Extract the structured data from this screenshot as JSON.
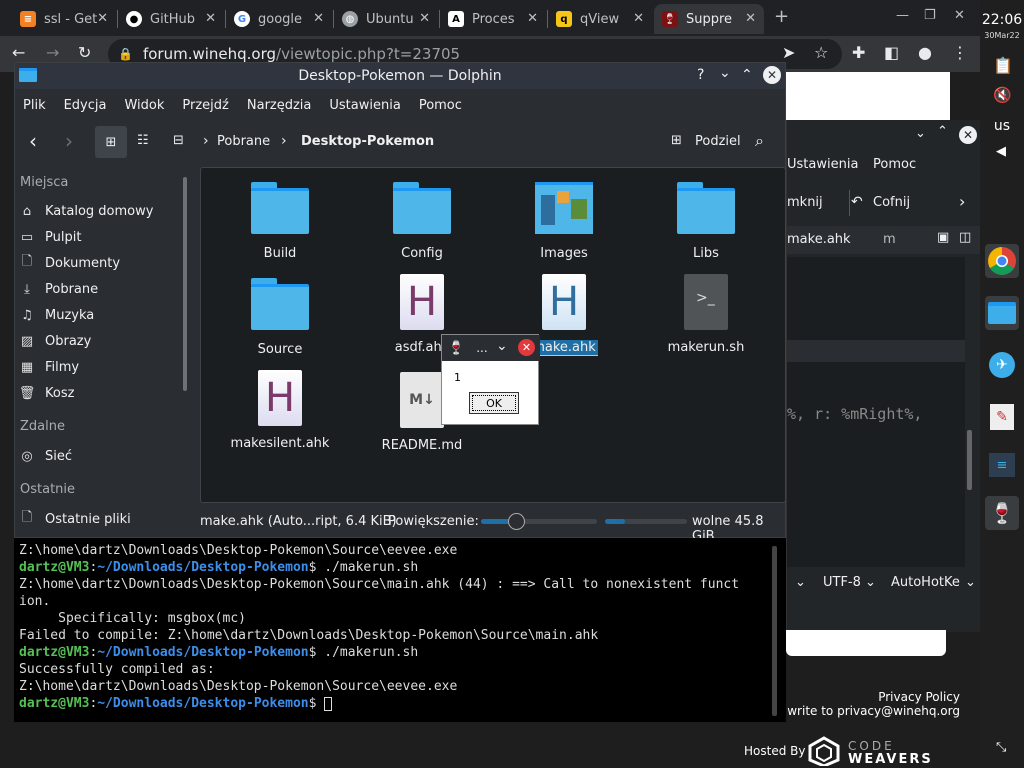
{
  "browser": {
    "tabs": [
      {
        "title": "ssl - Get",
        "icon": "stackoverflow-icon"
      },
      {
        "title": "GitHub",
        "icon": "github-icon"
      },
      {
        "title": "google",
        "icon": "google-icon"
      },
      {
        "title": "Ubuntu",
        "icon": "globe-icon"
      },
      {
        "title": "Proces",
        "icon": "a-icon"
      },
      {
        "title": "qView",
        "icon": "qview-icon"
      },
      {
        "title": "Suppre",
        "icon": "wine-icon"
      }
    ],
    "url_host": "forum.winehq.org",
    "url_path": "/viewtopic.php?t=23705"
  },
  "system": {
    "time": "22:06",
    "date": "30Mar22",
    "keyboard": "us"
  },
  "dolphin": {
    "title": "Desktop-Pokemon — Dolphin",
    "menu": [
      "Plik",
      "Edycja",
      "Widok",
      "Przejdź",
      "Narzędzia",
      "Ustawienia",
      "Pomoc"
    ],
    "breadcrumb": [
      "Pobrane",
      "Desktop-Pokemon"
    ],
    "split_label": "Podziel",
    "places": {
      "section1": "Miejsca",
      "items1": [
        "Katalog domowy",
        "Pulpit",
        "Dokumenty",
        "Pobrane",
        "Muzyka",
        "Obrazy",
        "Filmy",
        "Kosz"
      ],
      "section2": "Zdalne",
      "items2": [
        "Sieć"
      ],
      "section3": "Ostatnie",
      "items3": [
        "Ostatnie pliki"
      ]
    },
    "files": [
      {
        "name": "Build",
        "type": "folder"
      },
      {
        "name": "Config",
        "type": "folder"
      },
      {
        "name": "Images",
        "type": "image-folder"
      },
      {
        "name": "Libs",
        "type": "folder"
      },
      {
        "name": "Source",
        "type": "folder"
      },
      {
        "name": "asdf.ahk",
        "type": "ahk"
      },
      {
        "name": "make.ahk",
        "type": "ahk-selected"
      },
      {
        "name": "makerun.sh",
        "type": "sh"
      },
      {
        "name": "makesilent.ahk",
        "type": "ahk"
      },
      {
        "name": "README.md",
        "type": "md"
      }
    ],
    "status": {
      "selection": "make.ahk (Auto...ript, 6.4 KiB)",
      "zoom_label": "Powiększenie:",
      "zoom_level": 0.3,
      "free": "wolne 45.8 GiB"
    }
  },
  "terminal": {
    "lines": [
      {
        "t": "plain",
        "text": "Z:\\home\\dartz\\Downloads\\Desktop-Pokemon\\Source\\eevee.exe"
      },
      {
        "t": "prompt",
        "user": "dartz@VM3",
        "path": "~/Downloads/Desktop-Pokemon",
        "cmd": "$ ./makerun.sh"
      },
      {
        "t": "plain",
        "text": "Z:\\home\\dartz\\Downloads\\Desktop-Pokemon\\Source\\main.ahk (44) : ==> Call to nonexistent funct"
      },
      {
        "t": "plain",
        "text": "ion."
      },
      {
        "t": "plain",
        "text": "     Specifically: msgbox(mc)"
      },
      {
        "t": "plain",
        "text": "Failed to compile: Z:\\home\\dartz\\Downloads\\Desktop-Pokemon\\Source\\main.ahk"
      },
      {
        "t": "prompt",
        "user": "dartz@VM3",
        "path": "~/Downloads/Desktop-Pokemon",
        "cmd": "$ ./makerun.sh"
      },
      {
        "t": "plain",
        "text": "Successfully compiled as:"
      },
      {
        "t": "plain",
        "text": "Z:\\home\\dartz\\Downloads\\Desktop-Pokemon\\Source\\eevee.exe"
      },
      {
        "t": "prompt",
        "user": "dartz@VM3",
        "path": "~/Downloads/Desktop-Pokemon",
        "cmd": "$ "
      }
    ]
  },
  "msgbox": {
    "title": "...",
    "text": "1",
    "ok": "OK"
  },
  "behind": {
    "menu_settings": "Ustawienia",
    "menu_help": "Pomoc",
    "btn_close": "mknij",
    "btn_undo": "Cofnij",
    "tab_file": "make.ahk",
    "tab_next": "m",
    "code": "%, r: %mRight%,",
    "encoding": "UTF-8",
    "language": "AutoHotKe"
  },
  "web": {
    "privacy": "Privacy Policy",
    "write": "se write to privacy@winehq.org",
    "hosted": "Hosted By",
    "brand_top": "CODE",
    "brand_bottom": "WEAVERS"
  }
}
